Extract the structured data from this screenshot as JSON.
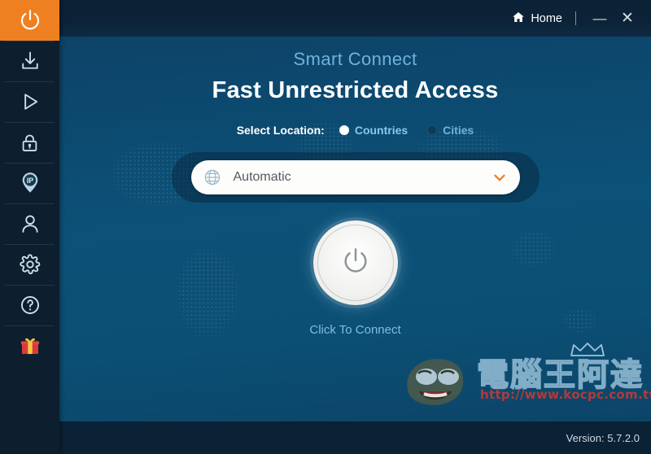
{
  "window": {
    "home_label": "Home",
    "minimize_label": "—",
    "close_label": "✕"
  },
  "sidebar": {
    "items": [
      {
        "icon": "power-icon",
        "name": "connect",
        "active": true
      },
      {
        "icon": "download-icon",
        "name": "download",
        "active": false
      },
      {
        "icon": "play-icon",
        "name": "streaming",
        "active": false
      },
      {
        "icon": "lock-icon",
        "name": "security",
        "active": false
      },
      {
        "icon": "ip-pin-icon",
        "name": "ip",
        "active": false
      },
      {
        "icon": "user-icon",
        "name": "account",
        "active": false
      },
      {
        "icon": "gear-icon",
        "name": "settings",
        "active": false
      },
      {
        "icon": "help-icon",
        "name": "help",
        "active": false
      },
      {
        "icon": "gift-icon",
        "name": "gift",
        "active": false
      }
    ]
  },
  "main": {
    "subtitle": "Smart Connect",
    "headline": "Fast Unrestricted Access",
    "select_location_label": "Select Location:",
    "options": [
      {
        "label": "Countries",
        "selected": true
      },
      {
        "label": "Cities",
        "selected": false
      }
    ],
    "dropdown": {
      "value": "Automatic",
      "icon": "globe-icon",
      "chevron": "chevron-down-icon"
    },
    "connect_button_icon": "power-icon",
    "connect_cta": "Click To Connect"
  },
  "watermark": {
    "title": "電腦王阿達",
    "url": "http://www.kocpc.com.tw"
  },
  "statusbar": {
    "version": "Version: 5.7.2.0"
  },
  "colors": {
    "accent_orange": "#ef8022",
    "sidebar_bg": "#0d1e2e",
    "titlebar_bg": "#0b2236",
    "main_bg": "#0c5178",
    "link_blue": "#7ebde4",
    "gift_red": "#d93b3b",
    "gift_gold": "#f4c842"
  }
}
